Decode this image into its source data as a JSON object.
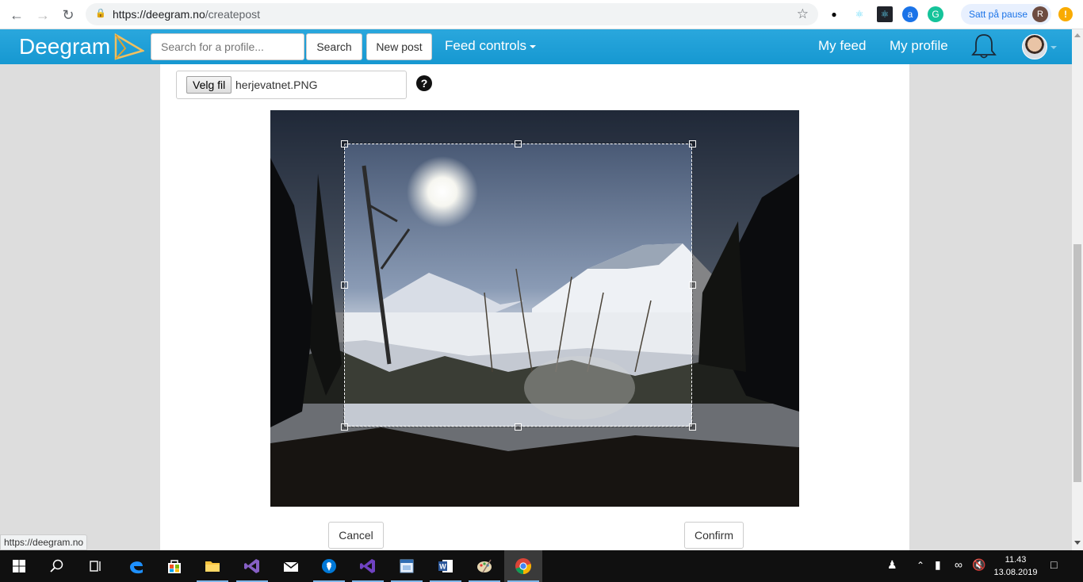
{
  "browser": {
    "url_host": "https://deegram.no",
    "url_path": "/createpost",
    "profile_status": "Satt på pause",
    "profile_initial": "R",
    "status_url": "https://deegram.no"
  },
  "app": {
    "logo": "Deegram",
    "search_placeholder": "Search for a profile...",
    "search_button": "Search",
    "new_post_button": "New post",
    "feed_controls": "Feed controls",
    "my_feed": "My feed",
    "my_profile": "My profile"
  },
  "upload": {
    "file_button": "Velg fil",
    "file_name": "herjevatnet.PNG",
    "help": "?"
  },
  "crop": {
    "cancel": "Cancel",
    "confirm": "Confirm"
  },
  "taskbar": {
    "time": "11.43",
    "date": "13.08.2019"
  },
  "colors": {
    "brand": "#1698d1",
    "taskbar": "#101010"
  }
}
